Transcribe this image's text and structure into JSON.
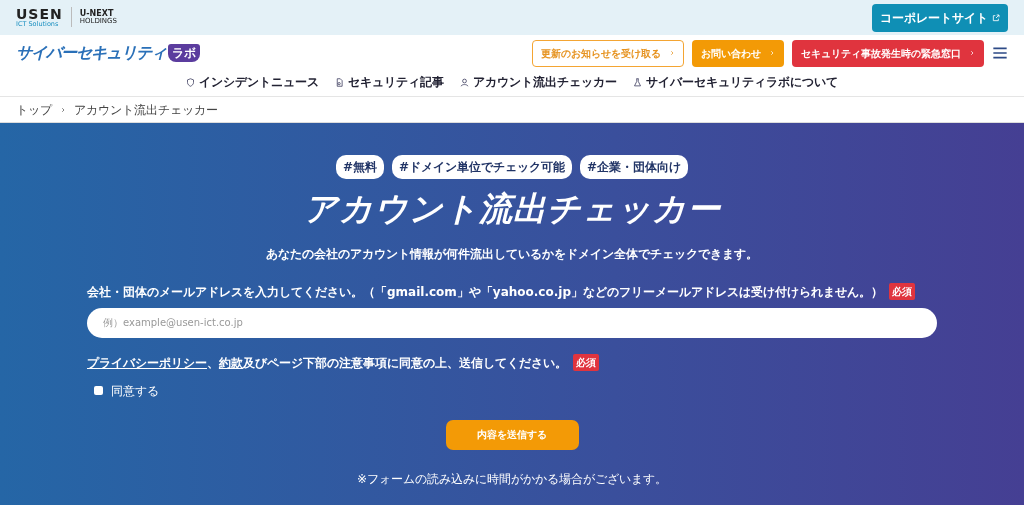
{
  "topbar": {
    "logo_main": "USEN",
    "logo_sub": "ICT Solutions",
    "partner_main": "U-NEXT",
    "partner_sub": "HOLDINGS",
    "corporate_button": "コーポレートサイト"
  },
  "header": {
    "site_title": "サイバーセキュリティ",
    "site_badge": "ラボ",
    "buttons": [
      {
        "label": "更新のお知らせを受け取る",
        "kind": "outline"
      },
      {
        "label": "お問い合わせ",
        "kind": "orange"
      },
      {
        "label": "セキュリティ事故発生時の緊急窓口",
        "kind": "red"
      }
    ],
    "nav": [
      {
        "label": "インシデントニュース"
      },
      {
        "label": "セキュリティ記事"
      },
      {
        "label": "アカウント流出チェッカー"
      },
      {
        "label": "サイバーセキュリティラボについて"
      }
    ]
  },
  "breadcrumb": [
    "トップ",
    "アカウント流出チェッカー"
  ],
  "hero": {
    "tags": [
      "#無料",
      "#ドメイン単位でチェック可能",
      "#企業・団体向け"
    ],
    "title": "アカウント流出チェッカー",
    "lead": "あなたの会社のアカウント情報が何件流出しているかをドメイン全体でチェックできます。",
    "email_label": "会社・団体のメールアドレスを入力してください。（「gmail.com」や「yahoo.co.jp」などのフリーメールアドレスは受け付けられません。）",
    "email_required": "必須",
    "email_placeholder": "例）example@usen-ict.co.jp",
    "consent": {
      "privacy_link": "プライバシーポリシー",
      "separator": "、",
      "terms_link": "約款",
      "rest": "及びページ下部の注意事項に同意の上、送信してください。",
      "required": "必須"
    },
    "agree": {
      "label": "同意する",
      "checked": false
    },
    "submit": "内容を送信する",
    "note": "※フォームの読み込みに時間がかかる場合がございます。"
  }
}
